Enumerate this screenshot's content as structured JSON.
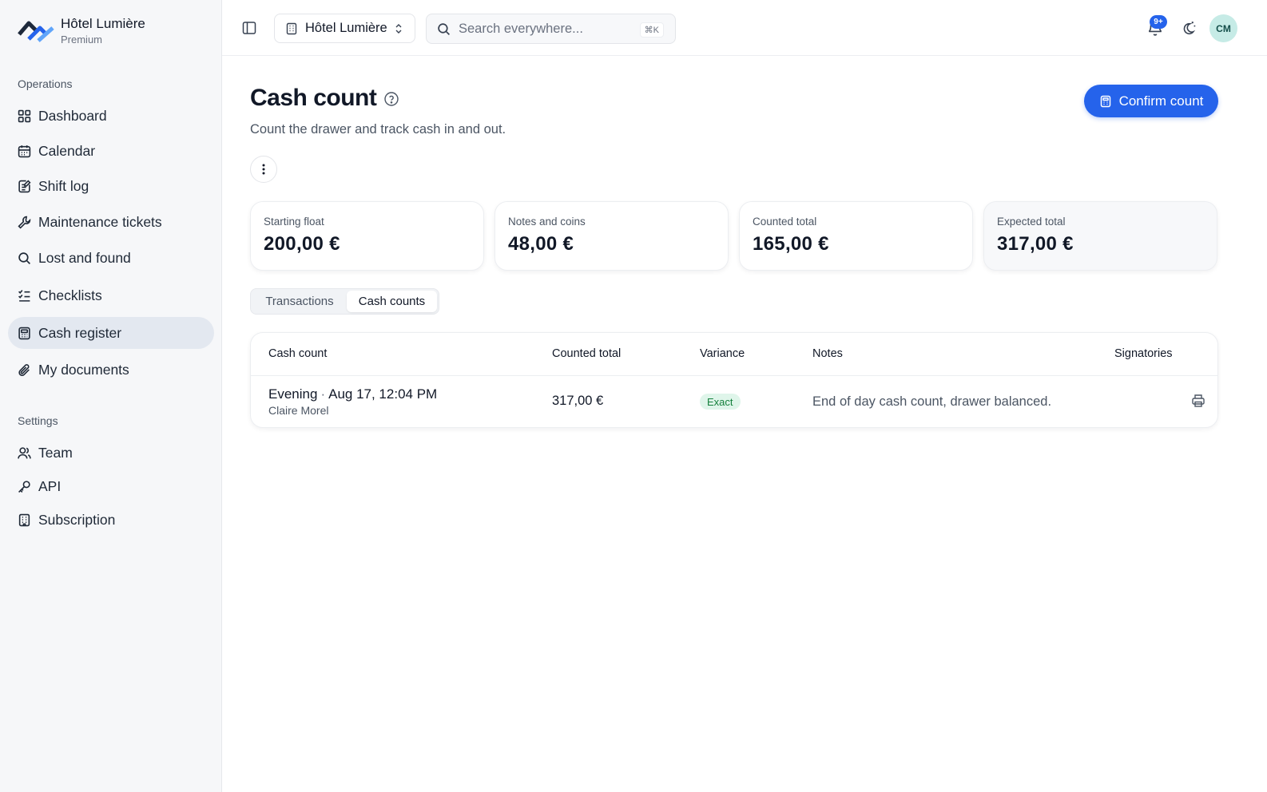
{
  "brand": {
    "name": "Hôtel Lumière",
    "plan": "Premium"
  },
  "sidebar": {
    "sections": [
      {
        "label": "Operations"
      },
      {
        "label": "Settings"
      }
    ],
    "items": [
      {
        "label": "Dashboard",
        "icon": "dashboard-icon"
      },
      {
        "label": "Calendar",
        "icon": "calendar-icon"
      },
      {
        "label": "Shift log",
        "icon": "shift-log-icon"
      },
      {
        "label": "Maintenance tickets",
        "icon": "wrench-icon"
      },
      {
        "label": "Lost and found",
        "icon": "search-icon"
      },
      {
        "label": "Checklists",
        "icon": "checklist-icon"
      },
      {
        "label": "Cash register",
        "icon": "cash-register-icon",
        "active": true
      },
      {
        "label": "My documents",
        "icon": "paperclip-icon"
      },
      {
        "label": "Team",
        "icon": "users-icon"
      },
      {
        "label": "API",
        "icon": "key-icon"
      },
      {
        "label": "Subscription",
        "icon": "building-icon"
      }
    ]
  },
  "topbar": {
    "hotel_select": "Hôtel Lumière",
    "search_placeholder": "Search everywhere...",
    "search_shortcut": "⌘K",
    "notifications_badge": "9+",
    "avatar_initials": "CM"
  },
  "page": {
    "title": "Cash count",
    "subtitle": "Count the drawer and track cash in and out.",
    "confirm_label": "Confirm count"
  },
  "stats": [
    {
      "label": "Starting float",
      "value": "200,00 €"
    },
    {
      "label": "Notes and coins",
      "value": "48,00 €"
    },
    {
      "label": "Counted total",
      "value": "165,00 €"
    },
    {
      "label": "Expected total",
      "value": "317,00 €"
    }
  ],
  "tabs": [
    {
      "label": "Transactions",
      "active": false
    },
    {
      "label": "Cash counts",
      "active": true
    }
  ],
  "table": {
    "headers": [
      "Cash count",
      "Counted total",
      "Variance",
      "Notes",
      "Signatories"
    ],
    "rows": [
      {
        "shift": "Evening",
        "datetime": "Aug 17, 12:04 PM",
        "person": "Claire Morel",
        "counted_total": "317,00 €",
        "variance": "Exact",
        "notes": "End of day cash count, drawer balanced."
      }
    ]
  },
  "colors": {
    "accent": "#2563eb",
    "sidebar_bg": "#f6f7f9",
    "active_bg": "#e3e8f0",
    "success_bg": "#dff5ea",
    "success_text": "#15803d"
  }
}
